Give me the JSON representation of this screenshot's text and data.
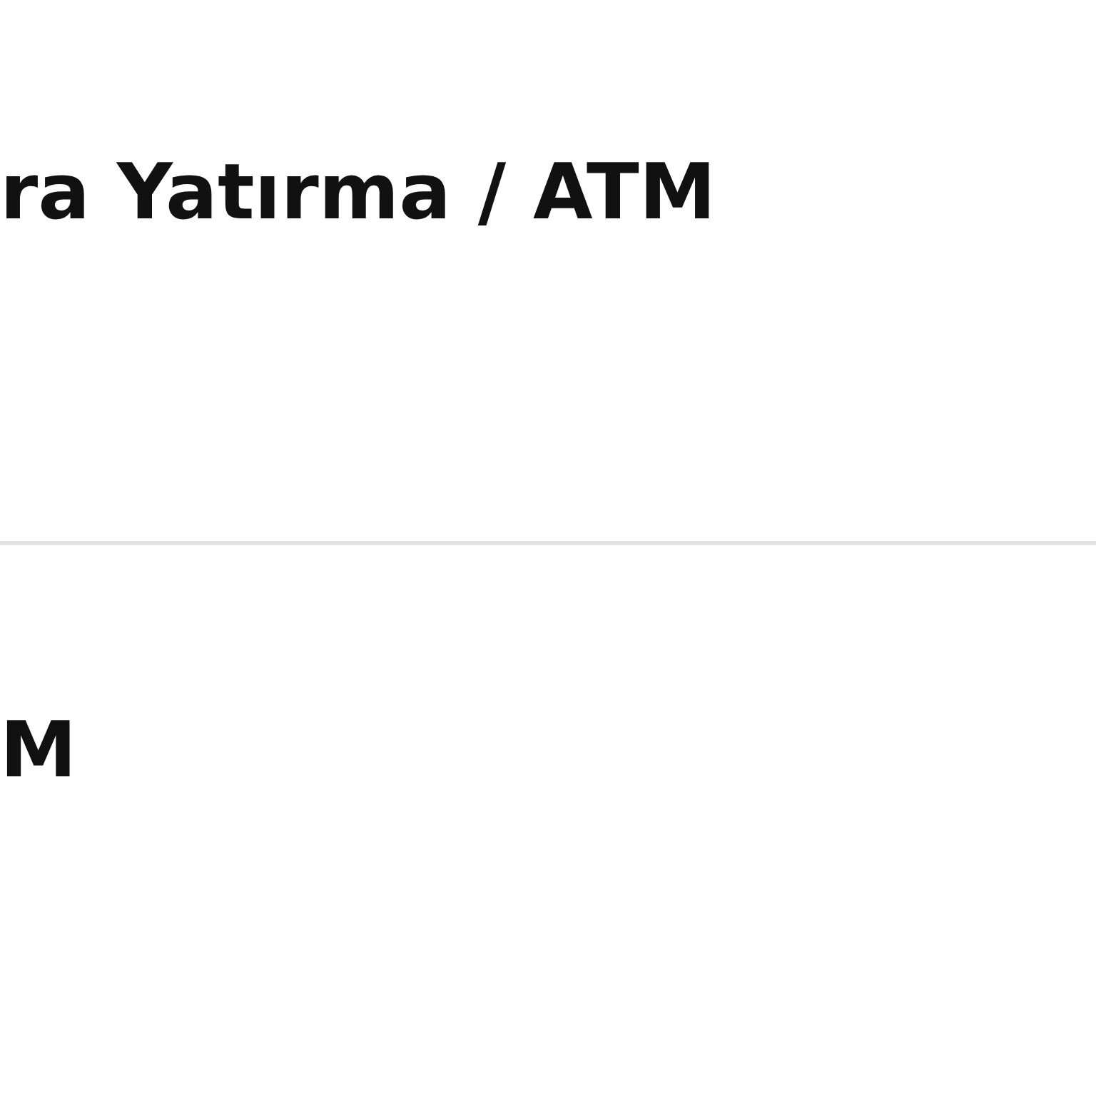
{
  "rows": [
    {
      "title": "ra Yatırma / ATM"
    },
    {
      "title": "M"
    }
  ]
}
